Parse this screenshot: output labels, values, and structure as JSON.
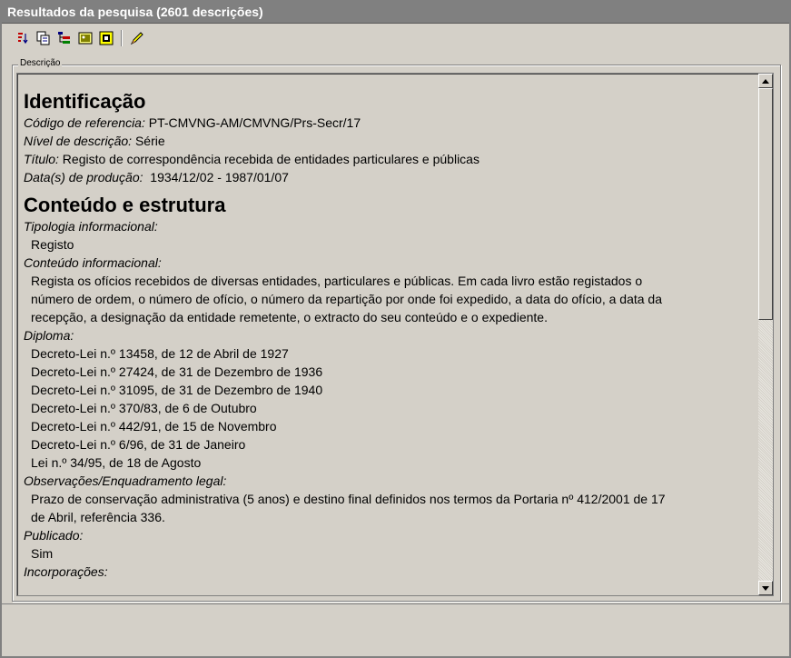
{
  "window": {
    "title": "Resultados da pesquisa (2601 descrições)"
  },
  "toolbar": {
    "buttons": [
      {
        "icon": "sort-icon"
      },
      {
        "icon": "copy-icon"
      },
      {
        "icon": "tree-icon"
      },
      {
        "icon": "image-icon"
      },
      {
        "icon": "export-icon"
      },
      {
        "icon": "pencil-icon"
      }
    ]
  },
  "group": {
    "label": "Descrição"
  },
  "record": {
    "section1": "Identificação",
    "codigo_label": "Código de referencia:",
    "codigo_value": " PT-CMVNG-AM/CMVNG/Prs-Secr/17",
    "nivel_label": "Nível de descrição:",
    "nivel_value": " Série",
    "titulo_label": "Título:",
    "titulo_value": " Registo de correspondência recebida de entidades particulares e públicas",
    "datas_label": "Data(s) de produção:",
    "datas_value": "  1934/12/02 - 1987/01/07",
    "section2": "Conteúdo e estrutura",
    "tipologia_label": "Tipologia informacional:",
    "tipologia_value": "Registo",
    "conteudo_label": "Conteúdo informacional:",
    "conteudo_lines": [
      "Regista os ofícios recebidos de diversas entidades, particulares e públicas. Em cada livro estão registados o",
      "número de ordem, o número de ofício, o número da repartição por onde foi expedido, a data do ofício, a data da",
      "recepção, a designação da entidade remetente, o extracto do seu conteúdo e o expediente."
    ],
    "diploma_label": "Diploma:",
    "diploma_items": [
      "Decreto-Lei n.º 13458, de 12 de Abril de 1927",
      "Decreto-Lei n.º 27424, de 31 de Dezembro de 1936",
      "Decreto-Lei n.º 31095, de 31 de Dezembro de 1940",
      "Decreto-Lei n.º 370/83, de 6 de Outubro",
      "Decreto-Lei n.º 442/91, de 15 de Novembro",
      "Decreto-Lei n.º 6/96, de 31 de Janeiro",
      "Lei n.º 34/95, de 18 de Agosto"
    ],
    "observacoes_label": "Observações/Enquadramento legal:",
    "observacoes_lines": [
      "Prazo de conservação administrativa (5 anos) e destino final definidos nos termos da Portaria nº 412/2001 de 17",
      "de Abril, referência 336."
    ],
    "publicado_label": "Publicado:",
    "publicado_value": "Sim",
    "incorporacoes_label": "Incorporações:"
  }
}
